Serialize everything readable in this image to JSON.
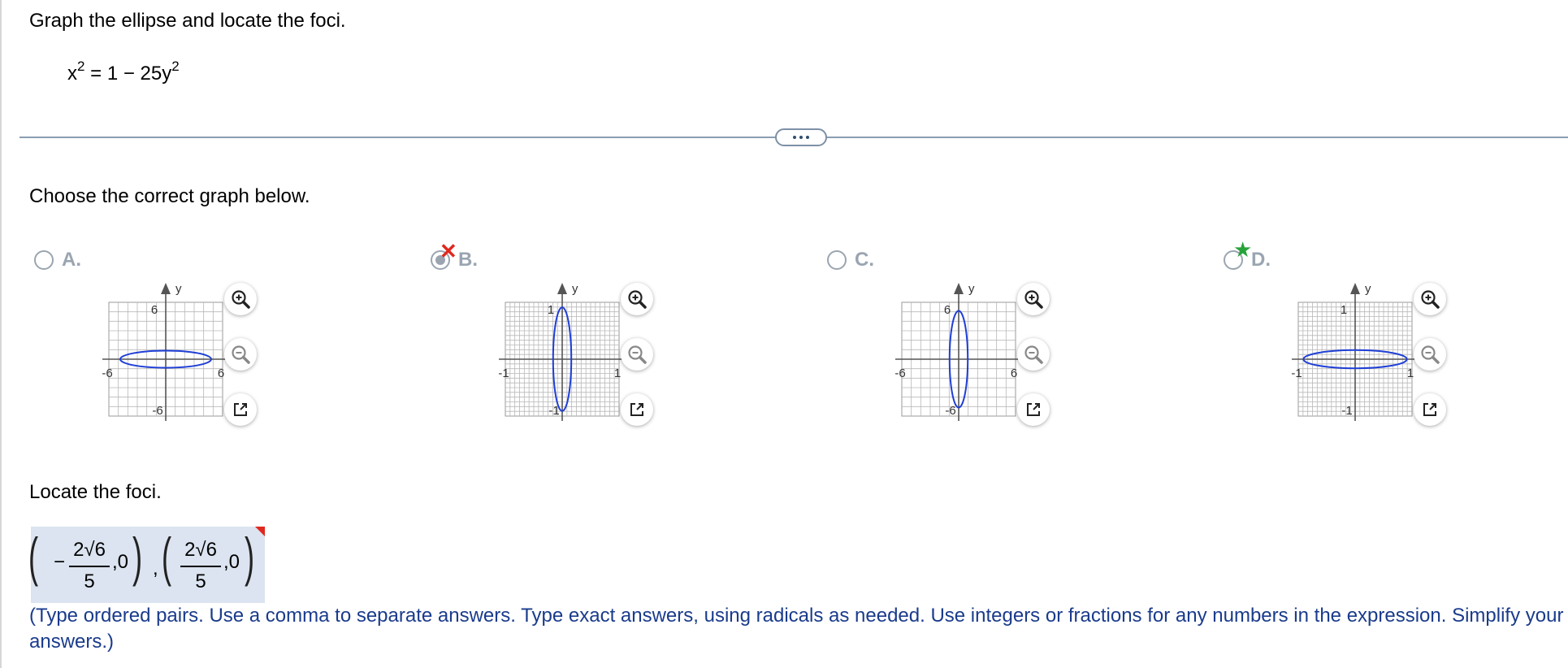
{
  "question": {
    "title": "Graph the ellipse and locate the foci.",
    "equation": {
      "lhs": "x",
      "exp1": "2",
      "rhs": "= 1 − 25y",
      "exp2": "2"
    }
  },
  "prompt": "Choose the correct graph below.",
  "options": [
    {
      "label": "A.",
      "state": "unselected",
      "tick_top": "6",
      "tick_bottom": "-6",
      "tick_left": "-6",
      "tick_right": "6",
      "axis_x": "x",
      "axis_y": "y"
    },
    {
      "label": "B.",
      "state": "selected-incorrect",
      "tick_top": "1",
      "tick_bottom": "-1",
      "tick_left": "-1",
      "tick_right": "1",
      "axis_x": "x",
      "axis_y": "y"
    },
    {
      "label": "C.",
      "state": "unselected",
      "tick_top": "6",
      "tick_bottom": "-6",
      "tick_left": "-6",
      "tick_right": "6",
      "axis_x": "x",
      "axis_y": "y"
    },
    {
      "label": "D.",
      "state": "correct",
      "tick_top": "1",
      "tick_bottom": "-1",
      "tick_left": "-1",
      "tick_right": "1",
      "axis_x": "x",
      "axis_y": "y"
    }
  ],
  "foci_section": {
    "heading": "Locate the foci.",
    "answer": {
      "minus": "−",
      "num1": "2√6",
      "den1": "5",
      "sep1": ",0",
      "comma": ",",
      "num2": "2√6",
      "den2": "5",
      "sep2": ",0"
    },
    "instructions": "(Type ordered pairs. Use a comma to separate answers.  Type exact answers, using radicals as needed. Use integers or fractions for any numbers in the expression. Simplify your answers.)"
  },
  "colors": {
    "ellipse": "#1f3fd6",
    "wrong_mark": "#e0281e",
    "correct_star": "#27a33a",
    "instruction_text": "#1a3b8c"
  },
  "icons": [
    "zoom-in-icon",
    "zoom-out-icon",
    "external-link-icon",
    "more-options-icon"
  ]
}
